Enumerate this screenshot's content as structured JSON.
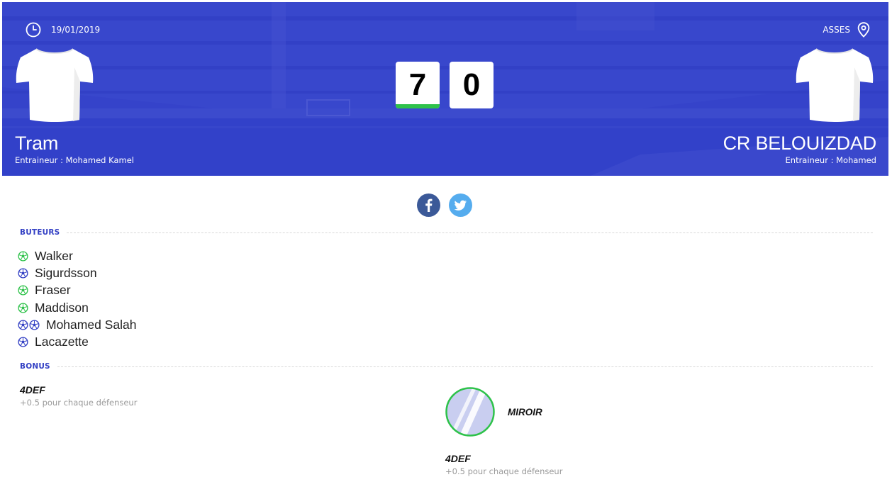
{
  "match": {
    "date": "19/01/2019",
    "location": "ASSES",
    "home": {
      "name": "Tram",
      "coach": "Entraineur : Mohamed Kamel",
      "score": "7"
    },
    "away": {
      "name": "CR BELOUIZDAD",
      "coach": "Entraineur : Mohamed",
      "score": "0"
    }
  },
  "icons": {
    "clock": "clock-icon",
    "location": "location-pin-icon",
    "facebook": "facebook-icon",
    "twitter": "twitter-icon",
    "ball": "football-icon"
  },
  "colors": {
    "accent": "#3340c4",
    "win": "#2ec24a",
    "facebook": "#3b5998",
    "twitter": "#55acee",
    "goal_green": "#2ec24a",
    "goal_blue": "#3340c4"
  },
  "sections": {
    "scorers_title": "BUTEURS",
    "bonus_title": "BONUS"
  },
  "scorers": [
    {
      "name": "Walker",
      "balls": [
        "green"
      ]
    },
    {
      "name": "Sigurdsson",
      "balls": [
        "blue"
      ]
    },
    {
      "name": "Fraser",
      "balls": [
        "green"
      ]
    },
    {
      "name": "Maddison",
      "balls": [
        "green"
      ]
    },
    {
      "name": "Mohamed Salah",
      "balls": [
        "blue",
        "blue"
      ]
    },
    {
      "name": "Lacazette",
      "balls": [
        "blue"
      ]
    }
  ],
  "bonus": {
    "home": {
      "title": "4DEF",
      "desc": "+0.5 pour chaque défenseur"
    },
    "mirror": {
      "label": "MIROIR"
    },
    "away": {
      "title": "4DEF",
      "desc": "+0.5 pour chaque défenseur"
    }
  }
}
